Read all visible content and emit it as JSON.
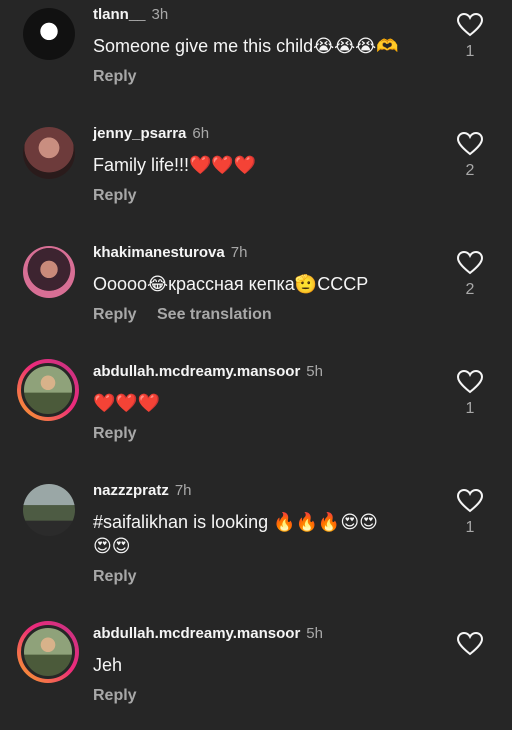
{
  "comments": [
    {
      "username": "tlann__",
      "time": "3h",
      "text": "Someone give me this child😭😭😭🫶",
      "likes": "1",
      "reply": "Reply"
    },
    {
      "username": "jenny_psarra",
      "time": "6h",
      "text": "Family life!!!❤️❤️❤️",
      "likes": "2",
      "reply": "Reply"
    },
    {
      "username": "khakimanesturova",
      "time": "7h",
      "text": "Ooooo😂крассная кепка🫡CCCP",
      "likes": "2",
      "reply": "Reply",
      "see_translation": "See translation"
    },
    {
      "username": "abdullah.mcdreamy.mansoor",
      "time": "5h",
      "text": "❤️❤️❤️",
      "likes": "1",
      "reply": "Reply"
    },
    {
      "username": "nazzzpratz",
      "time": "7h",
      "text_line1": "#saifalikhan is looking 🔥🔥🔥😍😍",
      "text_line2": "😍😍",
      "likes": "1",
      "reply": "Reply"
    },
    {
      "username": "abdullah.mcdreamy.mansoor",
      "time": "5h",
      "text": "Jeh",
      "reply": "Reply"
    }
  ],
  "icons": {
    "like": "heart-outline-icon"
  },
  "colors": {
    "background": "#262626",
    "text": "#f5f5f5",
    "muted": "#a8a8a8"
  }
}
